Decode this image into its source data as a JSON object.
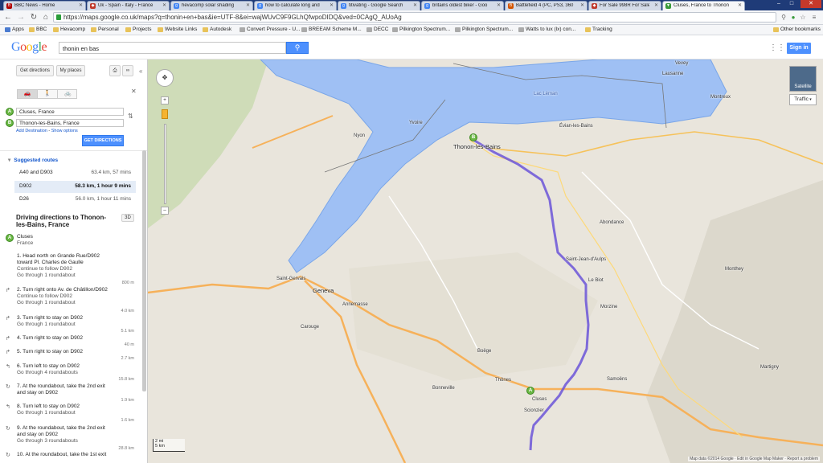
{
  "browser": {
    "tabs": [
      {
        "label": "BBC News - Home",
        "icon": "bbc-icon",
        "color": "#b20000"
      },
      {
        "label": "Uk - Spain - Italy - France",
        "icon": "shield-icon",
        "color": "#c0392b"
      },
      {
        "label": "hevacomp solar shading",
        "icon": "google-icon",
        "color": "#4285f4"
      },
      {
        "label": "how to calculate long and",
        "icon": "google-icon",
        "color": "#4285f4"
      },
      {
        "label": "titivating - Google Search",
        "icon": "google-icon",
        "color": "#4285f4"
      },
      {
        "label": "britains oldest biker - Goo",
        "icon": "google-icon",
        "color": "#4285f4"
      },
      {
        "label": "Battlefield 4 (PC, PS3, 360",
        "icon": "game-icon",
        "color": "#d35400"
      },
      {
        "label": "For Sale 998R For Sale",
        "icon": "tag-icon",
        "color": "#c0392b"
      },
      {
        "label": "Cluses, France to Thonon",
        "icon": "maps-icon",
        "color": "#3a9a3a"
      }
    ],
    "url": "https://maps.google.co.uk/maps?q=thonin+en+bas&ie=UTF-8&ei=wajWUvC9F9GLhQfwpoDIDQ&ved=0CAgQ_AUoAg",
    "bookmarks": [
      "Apps",
      "BBC",
      "Hevacomp",
      "Personal",
      "Projects",
      "Website Links",
      "Autodesk",
      "Convert Pressure - U...",
      "BREEAM Scheme M...",
      "DECC",
      "Pilkington Spectrum...",
      "Pilkington Spectrum...",
      "Watts to lux (lx) con...",
      "Tracking"
    ],
    "other_bookmarks": "Other bookmarks"
  },
  "header": {
    "logo": "Google",
    "search_value": "thonin en bas",
    "signin": "Sign in"
  },
  "panel": {
    "get_directions_tab": "Get directions",
    "my_places_tab": "My places",
    "from": "Cluses, France",
    "to": "Thonon-les-Bains, France",
    "add_destination": "Add Destination",
    "show_options": "Show options",
    "get_directions_btn": "GET DIRECTIONS",
    "suggested_routes": "Suggested routes",
    "routes": [
      {
        "name": "A40 and D903",
        "dist": "63.4 km, 57 mins"
      },
      {
        "name": "D902",
        "dist": "58.3 km, 1 hour 9 mins"
      },
      {
        "name": "D26",
        "dist": "56.0 km, 1 hour 11 mins"
      }
    ],
    "driving_title": "Driving directions to Thonon-les-Bains, France",
    "three_d": "3D",
    "start_name": "Cluses",
    "start_country": "France",
    "steps": [
      {
        "text": "1. Head north on Grande Rue/D902 toward Pl. Charles de Gaulle",
        "sub": "Continue to follow D902",
        "sub2": "Go through 1 roundabout",
        "dist": "800 m"
      },
      {
        "text": "2. Turn right onto Av. de Châtillon/D902",
        "sub": "Continue to follow D902",
        "sub2": "Go through 1 roundabout",
        "dist": "4.0 km"
      },
      {
        "text": "3. Turn right to stay on D902",
        "sub": "Go through 1 roundabout",
        "sub2": "",
        "dist": "5.1 km"
      },
      {
        "text": "4. Turn right to stay on D902",
        "sub": "",
        "sub2": "",
        "dist": "40 m"
      },
      {
        "text": "5. Turn right to stay on D902",
        "sub": "",
        "sub2": "",
        "dist": "2.7 km"
      },
      {
        "text": "6. Turn left to stay on D902",
        "sub": "Go through 4 roundabouts",
        "sub2": "",
        "dist": "15.8 km"
      },
      {
        "text": "7. At the roundabout, take the 2nd exit and stay on D902",
        "sub": "",
        "sub2": "",
        "dist": "1.9 km"
      },
      {
        "text": "8. Turn left to stay on D902",
        "sub": "Go through 1 roundabout",
        "sub2": "",
        "dist": "1.6 km"
      },
      {
        "text": "9. At the roundabout, take the 2nd exit and stay on D902",
        "sub": "Go through 3 roundabouts",
        "sub2": "",
        "dist": "28.8 km"
      },
      {
        "text": "10. At the roundabout, take the 1st exit",
        "sub": "",
        "sub2": "",
        "dist": ""
      }
    ]
  },
  "map": {
    "satellite": "Satellite",
    "traffic": "Traffic",
    "scale_mi": "2 mi",
    "scale_km": "5 km",
    "footer": "Map data ©2014 Google · Edit in Google Map Maker · Report a problem",
    "labels": [
      {
        "t": "Thonon-les-Bains",
        "big": true
      },
      {
        "t": "Geneva",
        "big": true
      },
      {
        "t": "Nyon",
        "big": false
      },
      {
        "t": "Lausanne",
        "big": false
      },
      {
        "t": "Vevey",
        "big": false
      },
      {
        "t": "Montreux",
        "big": false
      },
      {
        "t": "Évian-les-Bains",
        "big": false
      },
      {
        "t": "Cluses",
        "big": false
      },
      {
        "t": "Bonneville",
        "big": false
      },
      {
        "t": "Saint-Gervais",
        "big": false
      },
      {
        "t": "Annemasse",
        "big": false
      },
      {
        "t": "Morzine",
        "big": false
      },
      {
        "t": "Samoëns",
        "big": false
      },
      {
        "t": "Monthey",
        "big": false
      },
      {
        "t": "Martigny",
        "big": false
      },
      {
        "t": "Abondance",
        "big": false
      },
      {
        "t": "Saint-Jean-d'Aulps",
        "big": false
      },
      {
        "t": "Boëge",
        "big": false
      },
      {
        "t": "Carouge",
        "big": false
      },
      {
        "t": "Thônes",
        "big": false
      },
      {
        "t": "Scionzier",
        "big": false
      },
      {
        "t": "Lac Léman",
        "big": false
      },
      {
        "t": "Yvoire",
        "big": false
      },
      {
        "t": "Le Biot",
        "big": false
      }
    ]
  }
}
